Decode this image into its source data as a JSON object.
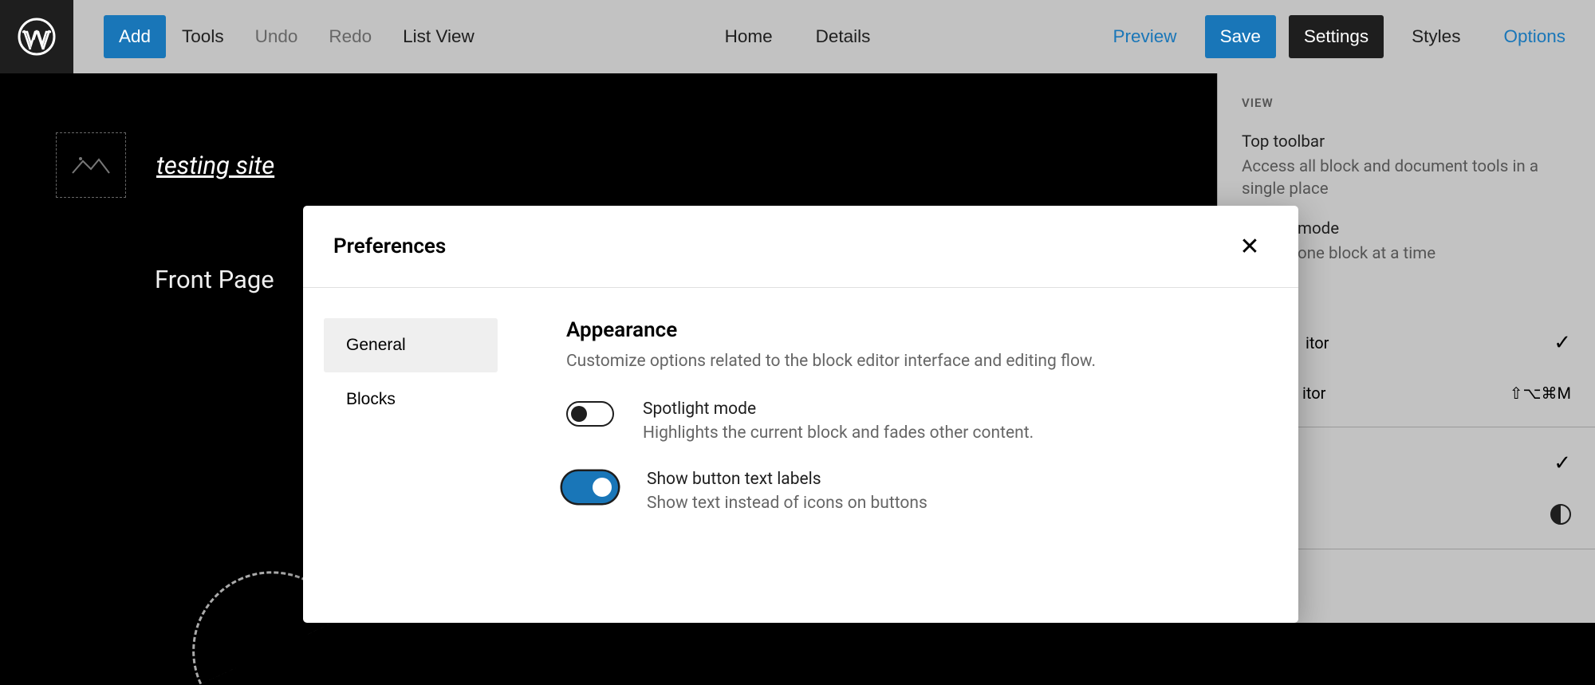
{
  "toolbar": {
    "add": "Add",
    "tools": "Tools",
    "undo": "Undo",
    "redo": "Redo",
    "listView": "List View",
    "home": "Home",
    "details": "Details",
    "preview": "Preview",
    "save": "Save",
    "settings": "Settings",
    "styles": "Styles",
    "options": "Options"
  },
  "site": {
    "title": "testing site",
    "page": "Front Page"
  },
  "sidebar": {
    "viewLabel": "VIEW",
    "items": [
      {
        "title": "Top toolbar",
        "desc": "Access all block and document tools in a single place"
      },
      {
        "title": "mode",
        "desc": "one block at a time"
      }
    ],
    "rows": [
      {
        "label": "itor",
        "icon": "check"
      },
      {
        "label": "itor",
        "shortcut": "⇧⌥⌘M"
      },
      {
        "label": "",
        "icon": "check"
      },
      {
        "label": "",
        "icon": "contrast"
      }
    ]
  },
  "modal": {
    "title": "Preferences",
    "tabs": [
      {
        "label": "General",
        "active": true
      },
      {
        "label": "Blocks",
        "active": false
      }
    ],
    "section": {
      "title": "Appearance",
      "desc": "Customize options related to the block editor interface and editing flow."
    },
    "prefs": [
      {
        "label": "Spotlight mode",
        "desc": "Highlights the current block and fades other content.",
        "on": false
      },
      {
        "label": "Show button text labels",
        "desc": "Show text instead of icons on buttons",
        "on": true
      }
    ]
  }
}
